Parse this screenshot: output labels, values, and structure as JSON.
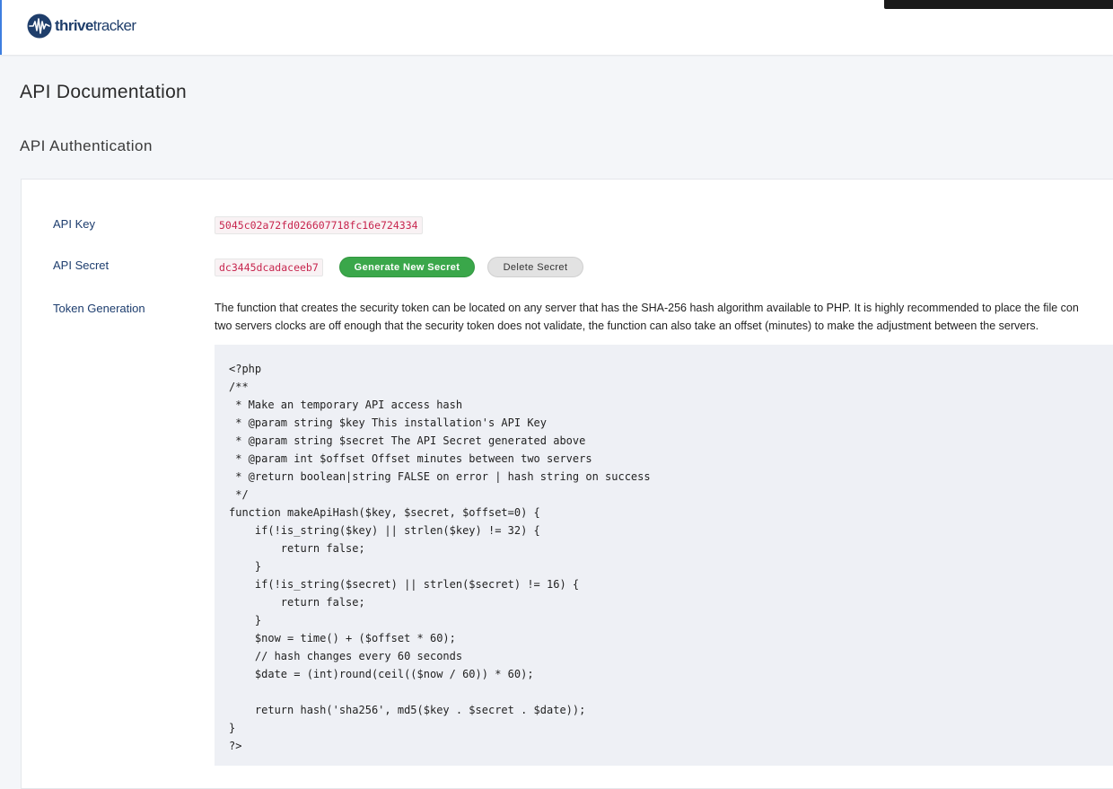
{
  "header": {
    "logo_thrive": "thrive",
    "logo_tracker": "tracker"
  },
  "page": {
    "title": "API Documentation",
    "section_title": "API Authentication"
  },
  "auth": {
    "api_key_label": "API Key",
    "api_key_value": "5045c02a72fd026607718fc16e724334",
    "api_secret_label": "API Secret",
    "api_secret_value": "dc3445dcadaceeb7",
    "generate_button": "Generate New Secret",
    "delete_button": "Delete Secret",
    "token_label": "Token Generation",
    "token_desc_line1": "The function that creates the security token can be located on any server that has the SHA-256 hash algorithm available to PHP. It is highly recommended to place the file con",
    "token_desc_line2": "two servers clocks are off enough that the security token does not validate, the function can also take an offset (minutes) to make the adjustment between the servers.",
    "code": "<?php\n/**\n * Make an temporary API access hash\n * @param string $key This installation's API Key\n * @param string $secret The API Secret generated above\n * @param int $offset Offset minutes between two servers\n * @return boolean|string FALSE on error | hash string on success\n */\nfunction makeApiHash($key, $secret, $offset=0) {\n    if(!is_string($key) || strlen($key) != 32) {\n        return false;\n    }\n    if(!is_string($secret) || strlen($secret) != 16) {\n        return false;\n    }\n    $now = time() + ($offset * 60);\n    // hash changes every 60 seconds\n    $date = (int)round(ceil(($now / 60)) * 60);\n\n    return hash('sha256', md5($key . $secret . $date));\n}\n?>"
  },
  "colors": {
    "brand": "#1f3e6b",
    "accent_green": "#3aa74a",
    "code_pink": "#c7254e"
  }
}
